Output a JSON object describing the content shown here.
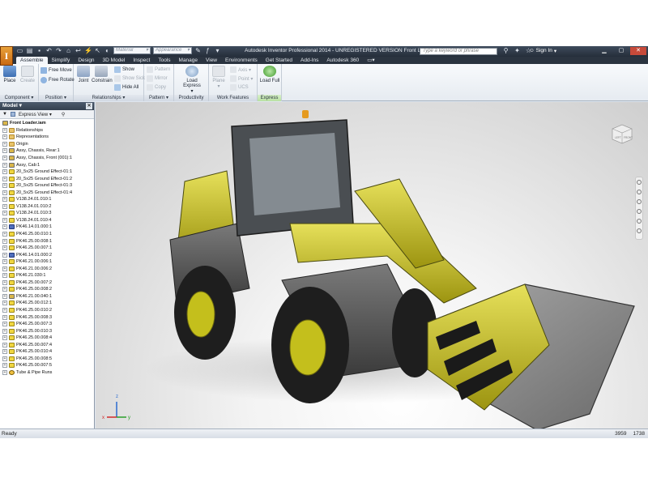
{
  "window": {
    "title": "Autodesk Inventor Professional 2014 - UNREGISTERED VERSION   Front Loader",
    "material_placeholder": "Material",
    "appearance_placeholder": "Appearance",
    "search_placeholder": "Type a keyword or phrase",
    "sign_in": "Sign In"
  },
  "tabs": [
    "Assemble",
    "Simplify",
    "Design",
    "3D Model",
    "Inspect",
    "Tools",
    "Manage",
    "View",
    "Environments",
    "Get Started",
    "Add-Ins",
    "Autodesk 360"
  ],
  "ribbon": {
    "component": {
      "place": "Place",
      "create": "Create",
      "footer": "Component ▾"
    },
    "position": {
      "free_move": "Free Move",
      "free_rotate": "Free Rotate",
      "footer": "Position ▾"
    },
    "relationships": {
      "joint": "Joint",
      "constrain": "Constrain",
      "show": "Show",
      "show_sick": "Show Sick",
      "hide_all": "Hide All",
      "footer": "Relationships ▾"
    },
    "pattern": {
      "pattern": "Pattern",
      "mirror": "Mirror",
      "copy": "Copy",
      "footer": "Pattern ▾"
    },
    "productivity": {
      "load_express": "Load Express",
      "footer": "Productivity"
    },
    "work_features": {
      "plane": "Plane",
      "axis": "Axis ▾",
      "point": "Point ▾",
      "ucs": "UCS",
      "footer": "Work Features"
    },
    "express": {
      "load_full": "Load Full",
      "footer": "Express"
    }
  },
  "browser": {
    "title": "Model ▾",
    "view_mode": "Express View",
    "root": "Front Loader.iam",
    "items": [
      {
        "label": "Relationships",
        "icon": "folder"
      },
      {
        "label": "Representations",
        "icon": "folder"
      },
      {
        "label": "Origin",
        "icon": "folder"
      },
      {
        "label": "Assy, Chassis, Rear:1",
        "icon": "asm"
      },
      {
        "label": "Assy, Chassis, Front (001):1",
        "icon": "asm"
      },
      {
        "label": "Assy, Cab:1",
        "icon": "asm"
      },
      {
        "label": "20_5x25 Ground Effect-01:1",
        "icon": "part"
      },
      {
        "label": "20_5x25 Ground Effect-01:2",
        "icon": "part"
      },
      {
        "label": "20_5x25 Ground Effect-01:3",
        "icon": "part"
      },
      {
        "label": "20_5x25 Ground Effect-01:4",
        "icon": "part"
      },
      {
        "label": "V138.24.01.010:1",
        "icon": "part"
      },
      {
        "label": "V138.24.01.010:2",
        "icon": "part"
      },
      {
        "label": "V138.24.01.010:3",
        "icon": "part"
      },
      {
        "label": "V138.24.01.010:4",
        "icon": "part"
      },
      {
        "label": "PK46.14.01.000:1",
        "icon": "multi"
      },
      {
        "label": "PK46.25.00.010:1",
        "icon": "part"
      },
      {
        "label": "PK46.25.00.008:1",
        "icon": "part"
      },
      {
        "label": "PK46.25.00.007:1",
        "icon": "part"
      },
      {
        "label": "PK46.14.01.000:2",
        "icon": "multi"
      },
      {
        "label": "PK46.21.00.006:1",
        "icon": "part"
      },
      {
        "label": "PK46.21.00.006:2",
        "icon": "part"
      },
      {
        "label": "PK46.21.030:1",
        "icon": "part"
      },
      {
        "label": "PK46.25.00.007:2",
        "icon": "part"
      },
      {
        "label": "PK46.25.00.008:2",
        "icon": "part"
      },
      {
        "label": "PK46.21.00.040:1",
        "icon": "asm"
      },
      {
        "label": "PK46.25.00.012:1",
        "icon": "part"
      },
      {
        "label": "PK46.25.00.010:2",
        "icon": "part"
      },
      {
        "label": "PK46.25.00.008:3",
        "icon": "part"
      },
      {
        "label": "PK46.25.00.007:3",
        "icon": "part"
      },
      {
        "label": "PK46.25.00.010:3",
        "icon": "part"
      },
      {
        "label": "PK46.25.00.008:4",
        "icon": "part"
      },
      {
        "label": "PK46.25.00.007:4",
        "icon": "part"
      },
      {
        "label": "PK46.25.00.010:4",
        "icon": "part"
      },
      {
        "label": "PK46.25.00.008:5",
        "icon": "part"
      },
      {
        "label": "PK46.25.00.007:5",
        "icon": "part"
      },
      {
        "label": "Tube & Pipe Runs",
        "icon": "tube"
      }
    ]
  },
  "viewcube": {
    "left": "LEFT",
    "front": "FRONT"
  },
  "axes": {
    "x": "x",
    "y": "y",
    "z": "z"
  },
  "status": {
    "text": "Ready",
    "num1": "3959",
    "num2": "1738"
  },
  "colors": {
    "accent": "#2b3440",
    "model_yellow": "#d8d230",
    "express_green": "#b9e0a2"
  }
}
